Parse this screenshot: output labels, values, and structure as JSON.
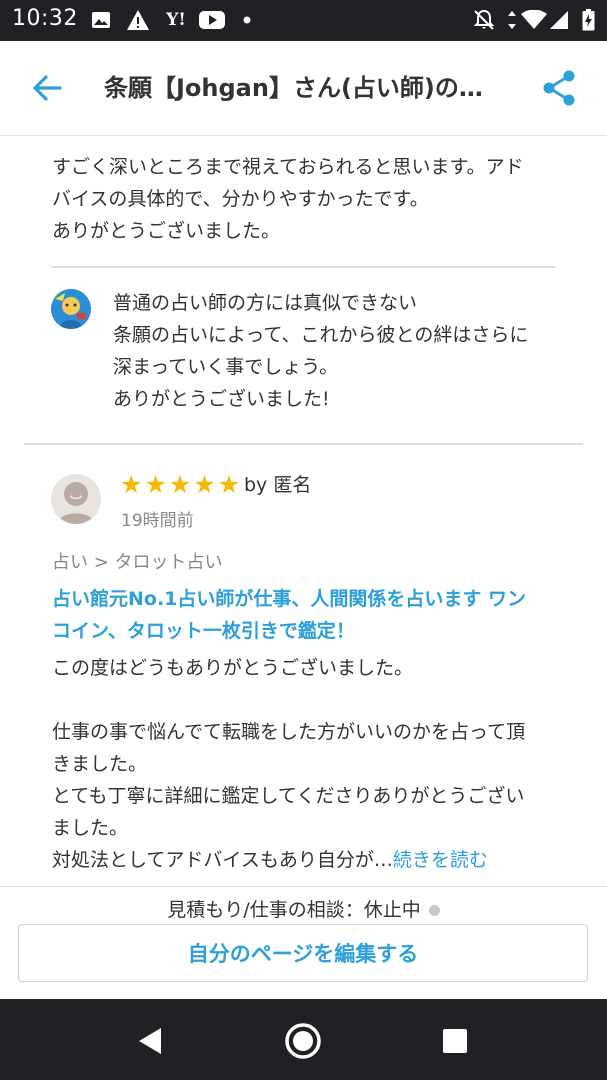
{
  "status_bar": {
    "time": "10:32",
    "left_icons": [
      "image-icon",
      "warning-icon",
      "yahoo-icon",
      "youtube-icon",
      "dot-icon"
    ],
    "right_icons": [
      "notifications-off-icon",
      "data-arrows-icon",
      "wifi-icon",
      "signal-icon",
      "battery-icon"
    ]
  },
  "app_bar": {
    "title": "条願【Johgan】さん(占い師)の…",
    "back_icon": "arrow-back-icon",
    "share_icon": "share-icon"
  },
  "review_1_tail": {
    "lines": [
      "すごく深いところまで視えておられると思います。アド",
      "バイスの具体的で、分かりやすかったです。",
      "ありがとうございました。"
    ]
  },
  "reply": {
    "avatar": "fortune-teller-avatar",
    "lines": [
      "普通の占い師の方には真似できない",
      "条願の占いによって、これから彼との絆はさらに",
      "深まっていく事でしょう。",
      "ありがとうございました!"
    ]
  },
  "review_2": {
    "avatar": "anonymous-user-avatar",
    "rating": 5,
    "stars": [
      "★",
      "★",
      "★",
      "★",
      "★"
    ],
    "by": "by 匿名",
    "time_ago": "19時間前",
    "breadcrumb": "占い > タロット占い",
    "service_title_lines": [
      "占い館元No.1占い師が仕事、人間関係を占います ワン",
      "コイン、タロット一枚引きで鑑定！"
    ],
    "body_para_1": "この度はどうもありがとうございました。",
    "body_para_2_lines": [
      "仕事の事で悩んでて転職をした方がいいのかを占って頂",
      "きました。",
      "とても丁寧に詳細に鑑定してくださりありがとうござい",
      "ました。"
    ],
    "body_last_line": "対処法としてアドバイスもあり自分が…",
    "read_more": "続きを読む"
  },
  "bottom_bar": {
    "quote_status": "見積もり/仕事の相談：休止中",
    "edit_button": "自分のページを編集する"
  },
  "nav_bar": {
    "buttons": [
      "back-triangle-icon",
      "home-circle-icon",
      "recents-square-icon"
    ]
  },
  "colors": {
    "accent": "#2d9fd9",
    "star": "#f6b800",
    "status_bar": "#202124",
    "text": "#333333",
    "muted": "#888888"
  }
}
